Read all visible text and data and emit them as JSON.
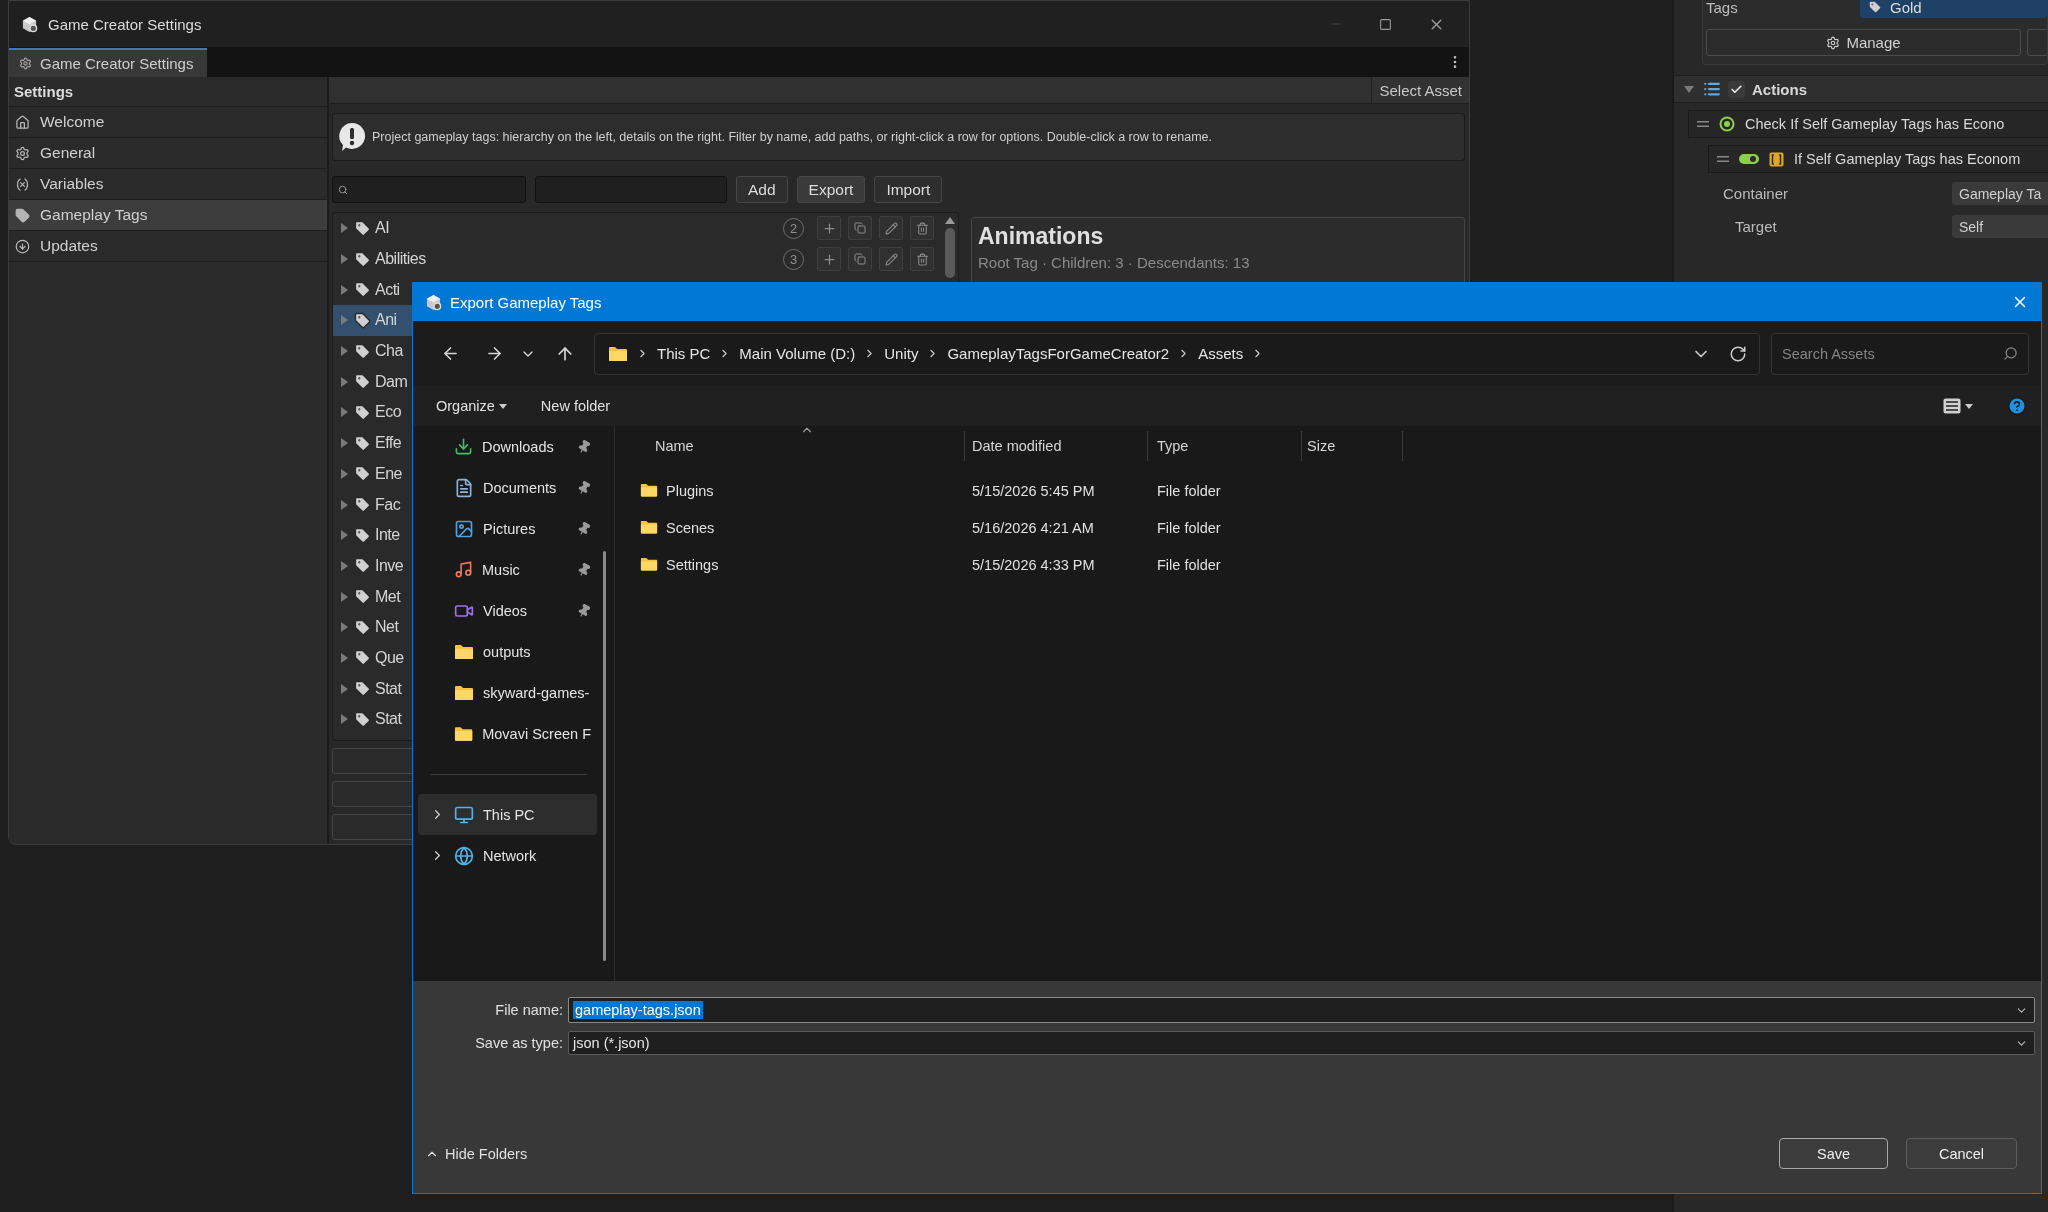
{
  "main_window": {
    "title": "Game Creator Settings",
    "tab": {
      "label": "Game Creator Settings",
      "selected": true
    },
    "sidebar": {
      "header": "Settings",
      "items": [
        {
          "label": "Welcome",
          "selected": false
        },
        {
          "label": "General",
          "selected": false
        },
        {
          "label": "Variables",
          "selected": false
        },
        {
          "label": "Gameplay Tags",
          "selected": true
        },
        {
          "label": "Updates",
          "selected": false
        }
      ]
    },
    "toolbar_button": "Select Asset",
    "info": "Project gameplay tags: hierarchy on the left, details on the right. Filter by name, add paths, or right-click a row for options. Double-click a row to rename.",
    "buttons": [
      "Add",
      "Export",
      "Import"
    ],
    "tree": [
      {
        "name": "AI",
        "count": "2",
        "selected": false,
        "expanded": false
      },
      {
        "name": "Abilities",
        "count": "3",
        "selected": false,
        "expanded": false
      },
      {
        "name": "Acti",
        "selected": false,
        "expanded": false
      },
      {
        "name": "Ani",
        "selected": true,
        "expanded": false
      },
      {
        "name": "Cha",
        "selected": false,
        "expanded": false
      },
      {
        "name": "Dam",
        "selected": false,
        "expanded": false
      },
      {
        "name": "Eco",
        "selected": false,
        "expanded": false
      },
      {
        "name": "Effe",
        "selected": false,
        "expanded": false
      },
      {
        "name": "Ene",
        "selected": false,
        "expanded": false
      },
      {
        "name": "Fac",
        "selected": false,
        "expanded": false
      },
      {
        "name": "Inte",
        "selected": false,
        "expanded": false
      },
      {
        "name": "Inve",
        "selected": false,
        "expanded": false
      },
      {
        "name": "Met",
        "selected": false,
        "expanded": false
      },
      {
        "name": "Net",
        "selected": false,
        "expanded": false
      },
      {
        "name": "Que",
        "selected": false,
        "expanded": false
      },
      {
        "name": "Stat",
        "selected": false,
        "expanded": false
      },
      {
        "name": "Stat",
        "selected": false,
        "expanded": false
      }
    ],
    "details": {
      "title": "Animations",
      "subtitle": "Root Tag · Children: 3 · Descendants: 13"
    }
  },
  "inspector": {
    "tags": {
      "label": "Tags",
      "value": "Gold"
    },
    "manage_button": "Manage",
    "actions": {
      "title": "Actions",
      "expanded": true,
      "checked": true,
      "items": [
        {
          "kind": "check",
          "label": "Check If Self Gameplay Tags has Econo"
        },
        {
          "kind": "condition",
          "label": "If Self Gameplay Tags has Econom",
          "enabled": true
        }
      ]
    },
    "fields": [
      {
        "label": "Container",
        "value": "Gameplay Ta"
      },
      {
        "label": "Target",
        "value": "Self"
      }
    ]
  },
  "dialog": {
    "title": "Export Gameplay Tags",
    "breadcrumbs": [
      "This PC",
      "Main Volume (D:)",
      "Unity",
      "GameplayTagsForGameCreator2",
      "Assets"
    ],
    "search": {
      "placeholder": "Search Assets"
    },
    "commands": [
      "Organize",
      "New folder"
    ],
    "quick_access": [
      {
        "label": "Downloads",
        "pinned": true
      },
      {
        "label": "Documents",
        "pinned": true
      },
      {
        "label": "Pictures",
        "pinned": true
      },
      {
        "label": "Music",
        "pinned": true
      },
      {
        "label": "Videos",
        "pinned": true
      },
      {
        "label": "outputs",
        "pinned": false
      },
      {
        "label": "skyward-games-",
        "pinned": false
      },
      {
        "label": "Movavi Screen F",
        "pinned": false
      }
    ],
    "locations": [
      {
        "label": "This PC",
        "selected": true,
        "expanded": false
      },
      {
        "label": "Network",
        "selected": false,
        "expanded": false
      }
    ],
    "columns": [
      "Name",
      "Date modified",
      "Type",
      "Size"
    ],
    "files": [
      {
        "name": "Plugins",
        "date": "5/15/2026 5:45 PM",
        "type": "File folder"
      },
      {
        "name": "Scenes",
        "date": "5/16/2026 4:21 AM",
        "type": "File folder"
      },
      {
        "name": "Settings",
        "date": "5/15/2026 4:33 PM",
        "type": "File folder"
      }
    ],
    "file_name": {
      "label": "File name:",
      "value": "gameplay-tags.json"
    },
    "save_type": {
      "label": "Save as type:",
      "value": "json (*.json)"
    },
    "hide_folders": "Hide Folders",
    "buttons": [
      "Save",
      "Cancel"
    ]
  }
}
